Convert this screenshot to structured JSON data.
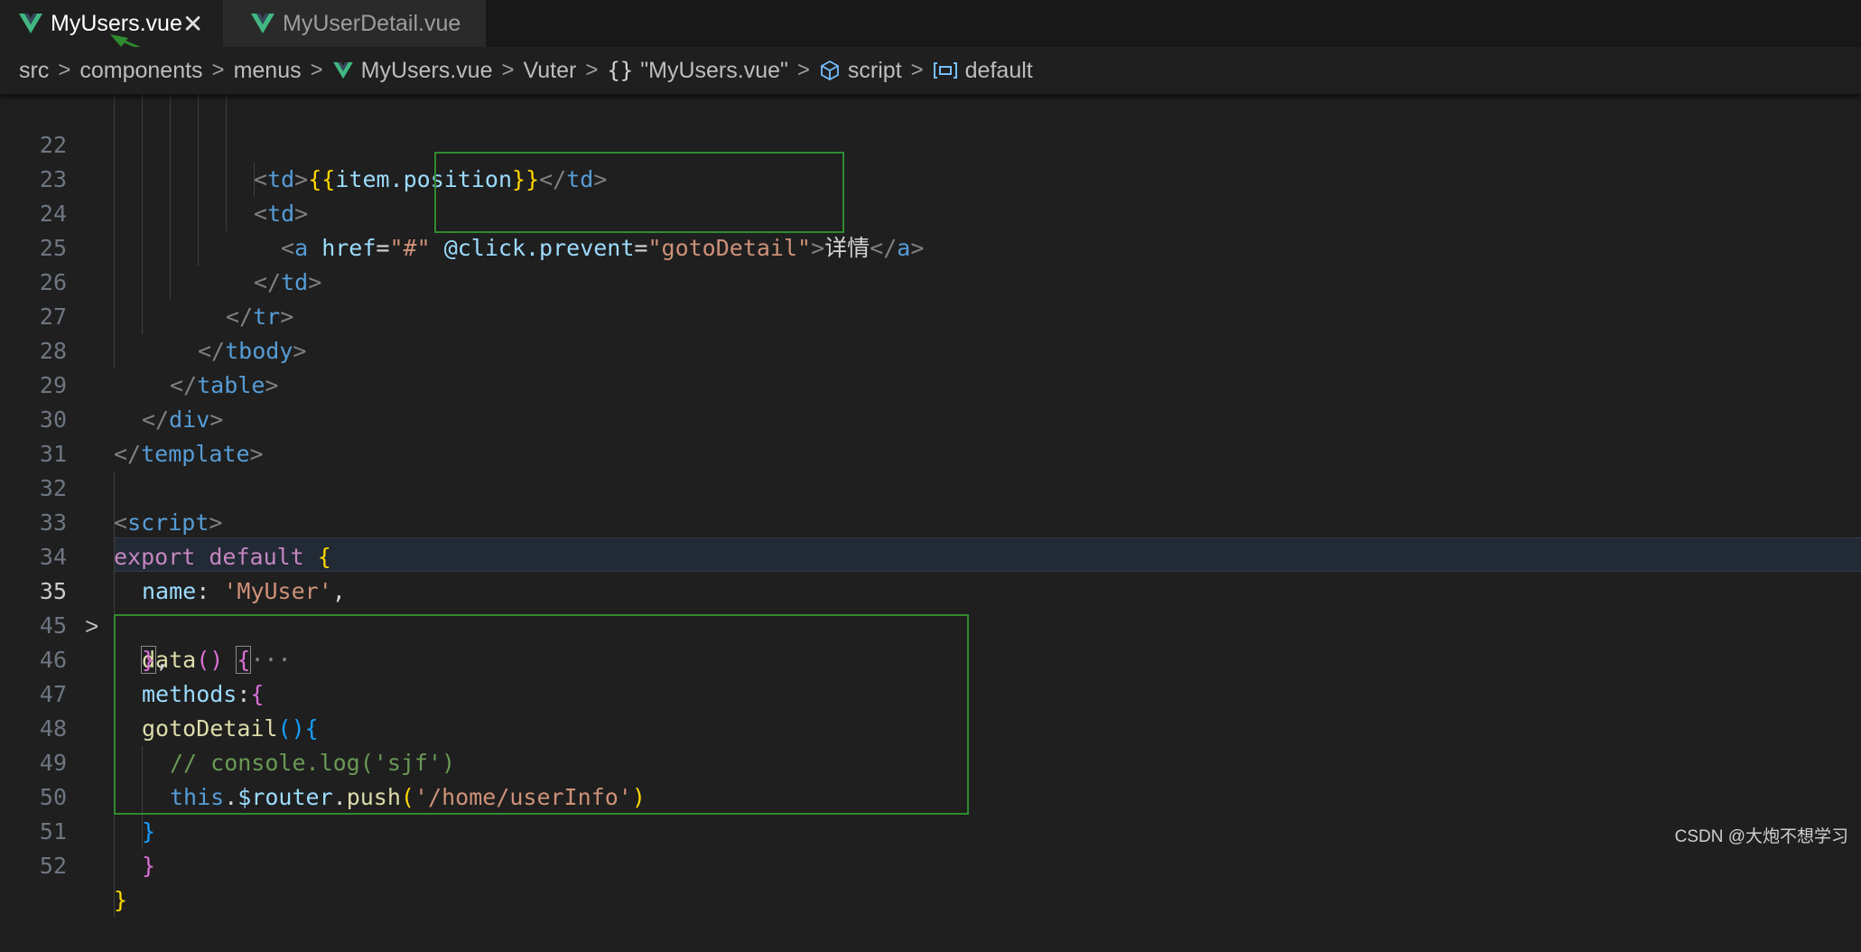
{
  "tabs": [
    {
      "label": "MyUsers.vue",
      "active": true,
      "close": "✕"
    },
    {
      "label": "MyUserDetail.vue",
      "active": false
    }
  ],
  "breadcrumb": {
    "items": [
      "src",
      "components",
      "menus",
      "MyUsers.vue",
      "Vuter",
      "\"MyUsers.vue\"",
      "script",
      "default"
    ],
    "icons": [
      "vue-icon",
      "braces-icon",
      "cube-icon",
      "field-icon"
    ]
  },
  "editor": {
    "line_numbers": [
      "22",
      "23",
      "24",
      "25",
      "26",
      "27",
      "28",
      "29",
      "30",
      "31",
      "32",
      "33",
      "34",
      "35",
      "45",
      "46",
      "47",
      "48",
      "49",
      "50",
      "51",
      "52"
    ],
    "current_line": "35",
    "code": {
      "l22": {
        "open": "<",
        "tag": "td",
        "close": ">",
        "b_open": "{{",
        "expr": "item.position",
        "b_close": "}}",
        "end_open": "</",
        "end_tag": "td",
        "end_close": ">"
      },
      "l23": {
        "open": "<",
        "tag": "td",
        "close": ">"
      },
      "l24": {
        "open": "<",
        "tag": "a",
        "attr_href": "href",
        "eq": "=",
        "href_val": "\"#\"",
        "attr_click": "@click.prevent",
        "eq2": "=",
        "click_val": "\"gotoDetail\"",
        "close": ">",
        "text": "详情",
        "end_open": "</",
        "end_tag": "a",
        "end_close": ">"
      },
      "l25": {
        "end_open": "</",
        "tag": "td",
        "close": ">"
      },
      "l26": {
        "end_open": "</",
        "tag": "tr",
        "close": ">"
      },
      "l27": {
        "end_open": "</",
        "tag": "tbody",
        "close": ">"
      },
      "l28": {
        "end_open": "</",
        "tag": "table",
        "close": ">"
      },
      "l29": {
        "end_open": "</",
        "tag": "div",
        "close": ">"
      },
      "l30": {
        "end_open": "</",
        "tag": "template",
        "close": ">"
      },
      "l32": {
        "open": "<",
        "tag": "script",
        "close": ">"
      },
      "l33": {
        "kw1": "export",
        "kw2": "default",
        "brace": "{"
      },
      "l34": {
        "key": "name",
        "colon": ":",
        "val": "'MyUser'",
        "comma": ","
      },
      "l35": {
        "fn": "data",
        "parens": "()",
        "brace": "{",
        "ellipsis": "···"
      },
      "l45": {
        "brace": "}",
        "comma": ","
      },
      "l46": {
        "key": "methods",
        "colon": ":",
        "brace": "{"
      },
      "l47": {
        "fn": "gotoDetail",
        "parens": "()",
        "brace": "{"
      },
      "l48": {
        "comment": "// console.log('sjf')"
      },
      "l49": {
        "this": "this",
        "dot1": ".",
        "prop": "$router",
        "dot2": ".",
        "fn": "push",
        "p_open": "(",
        "str": "'/home/userInfo'",
        "p_close": ")"
      },
      "l50": {
        "brace": "}"
      },
      "l51": {
        "brace": "}"
      },
      "l52": {
        "brace": "}"
      }
    }
  },
  "watermark": "CSDN @大炮不想学习",
  "colors": {
    "highlight_box": "#2e8b2e",
    "arrow": "#2e8b2e",
    "vue_green": "#41b883",
    "vue_dark": "#35495e"
  }
}
